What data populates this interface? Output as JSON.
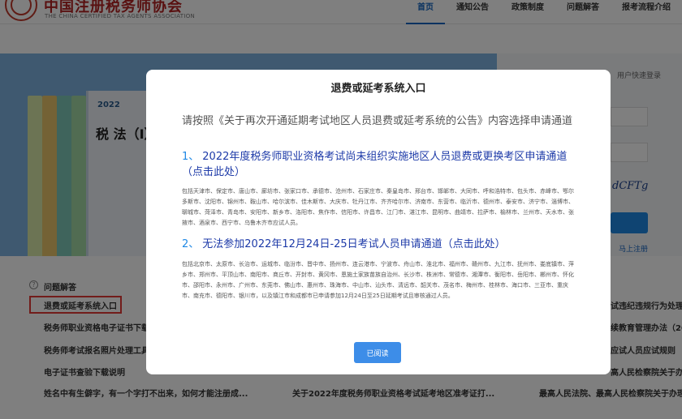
{
  "header": {
    "site_name": "中国注册税务师协会",
    "site_name_en": "THE CHINA CERTIFIED TAX AGENTS ASSOCIATION",
    "nav": [
      "首页",
      "通知公告",
      "政策制度",
      "问题解答",
      "报考流程介绍"
    ]
  },
  "banner": {
    "book_year": "2022",
    "book_title": "税 法（I）"
  },
  "login": {
    "hint": "用户快速登录",
    "captcha": "dCFTg",
    "register": "马上注册"
  },
  "faq": {
    "title": "问题解答",
    "items": [
      "退费或延考系统入口",
      "税务师职业资格电子证书下载",
      "税务师考试报名照片处理工具",
      "电子证书查验下载说明",
      "姓名中有生僻字，有一个字打不出来，如何才能注册成..."
    ]
  },
  "mid_item": "关于2022年度税务师职业资格考试延考地区准考证打...",
  "right_items": [
    "试违纪违规行为处理",
    "续教育管理办法（20",
    "应试人员应试规则",
    "高人民检察院关于办",
    "最高人民法院、最高人民检察院关于办理"
  ],
  "modal": {
    "title": "退费或延考系统入口",
    "intro": "请按照《关于再次开通延期考试地区人员退费或延考系统的公告》内容选择申请通道",
    "section1": {
      "num": "1、",
      "link": "2022年度税务师职业资格考试尚未组织实施地区人员退费或更换考区申请通道（点击此处）",
      "cities": "包括天津市、保定市、唐山市、廊坊市、张家口市、承德市、沧州市、石家庄市、秦皇岛市、邢台市、邯郸市、大同市、呼和浩特市、包头市、赤峰市、鄂尔多斯市、沈阳市、锦州市、鞍山市、哈尔滨市、佳木斯市、大庆市、牡丹江市、齐齐哈尔市、济南市、东营市、临沂市、德州市、泰安市、济宁市、淄博市、聊城市、菏泽市、青岛市、安阳市、新乡市、洛阳市、焦作市、信阳市、许昌市、江门市、湛江市、昆明市、曲靖市、拉萨市、榆林市、兰州市、天水市、张掖市、酒泉市、西宁市、乌鲁木齐市应试人员。"
    },
    "section2": {
      "num": "2、",
      "link": "无法参加2022年12月24日-25日考试人员申请通道（点击此处）",
      "cities": "包括北京市、太原市、长治市、运城市、临汾市、晋中市、扬州市、连云港市、宁波市、舟山市、淮北市、福州市、赣州市、九江市、抚州市、娄底镇市、萍乡市、郑州市、平顶山市、南阳市、商丘市、开封市、黄冈市、恩施土家族苗族自治州、长沙市、株洲市、常德市、湘潭市、衡阳市、岳阳市、郴州市、怀化市、邵阳市、永州市、广州市、东莞市、佛山市、惠州市、珠海市、中山市、汕头市、清远市、韶关市、茂名市、梅州市、桂林市、海口市、三亚市、重庆市、南充市、德阳市、银川市，以及镇江市和成都市已申请参加12月24日至25日延期考试且审核通过人员。"
    },
    "button": "已阅读"
  }
}
